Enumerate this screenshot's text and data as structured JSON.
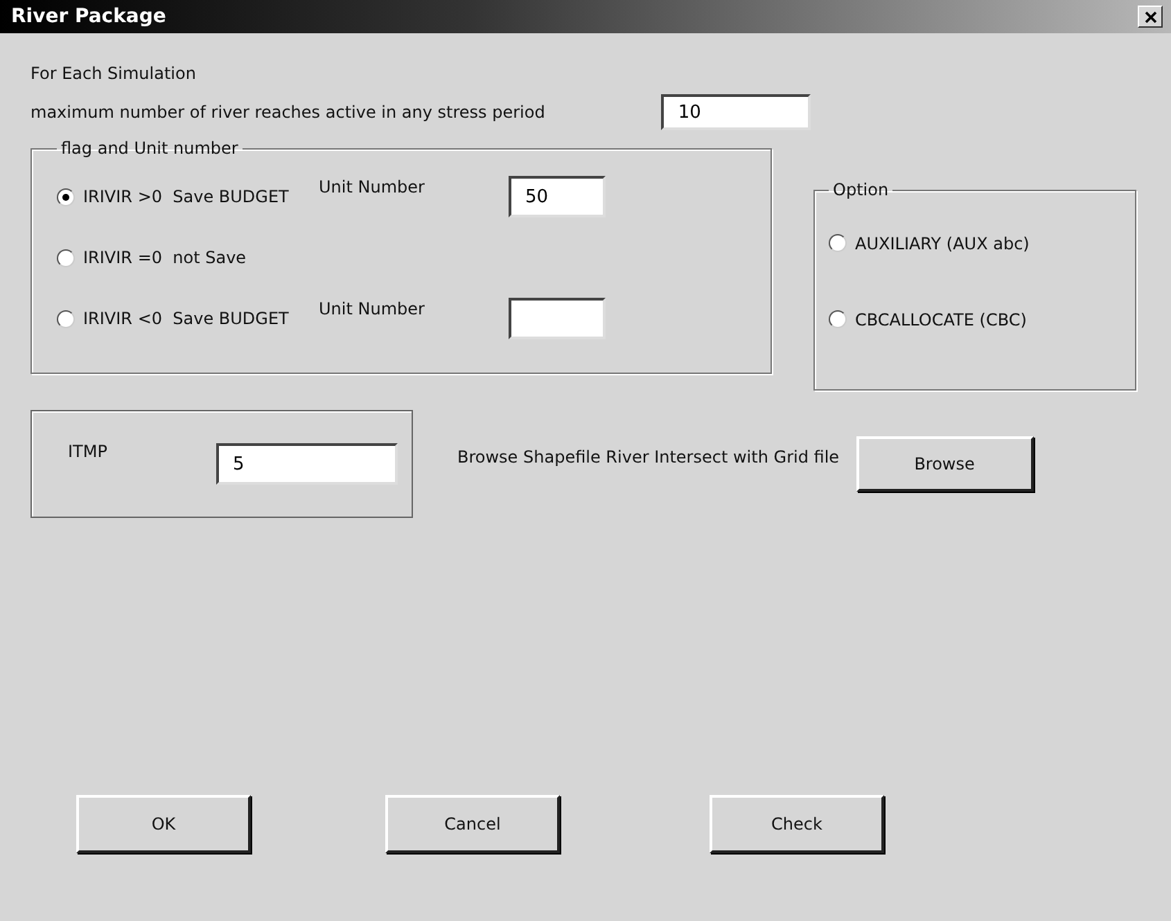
{
  "window": {
    "title": "River Package"
  },
  "intro": "For Each Simulation",
  "max_reaches": {
    "label": "maximum number of river reaches active in any stress period",
    "value": "10"
  },
  "flag_group": {
    "title": "flag and Unit number",
    "options": [
      {
        "label": "IRIVIR >0  Save BUDGET",
        "selected": true,
        "unit": {
          "label": "Unit Number",
          "value": "50"
        }
      },
      {
        "label": "IRIVIR =0  not Save",
        "selected": false
      },
      {
        "label": "IRIVIR <0  Save BUDGET",
        "selected": false,
        "unit": {
          "label": "Unit Number"
        }
      }
    ]
  },
  "option_group": {
    "title": "Option",
    "options": [
      {
        "label": "AUXILIARY (AUX abc)",
        "selected": false
      },
      {
        "label": "CBCALLOCATE (CBC)",
        "selected": false
      }
    ]
  },
  "itmp": {
    "label": "ITMP",
    "value": "5"
  },
  "browse": {
    "label": "Browse Shapefile River Intersect with Grid file",
    "button": "Browse"
  },
  "buttons": [
    "OK",
    "Cancel",
    "Check"
  ]
}
